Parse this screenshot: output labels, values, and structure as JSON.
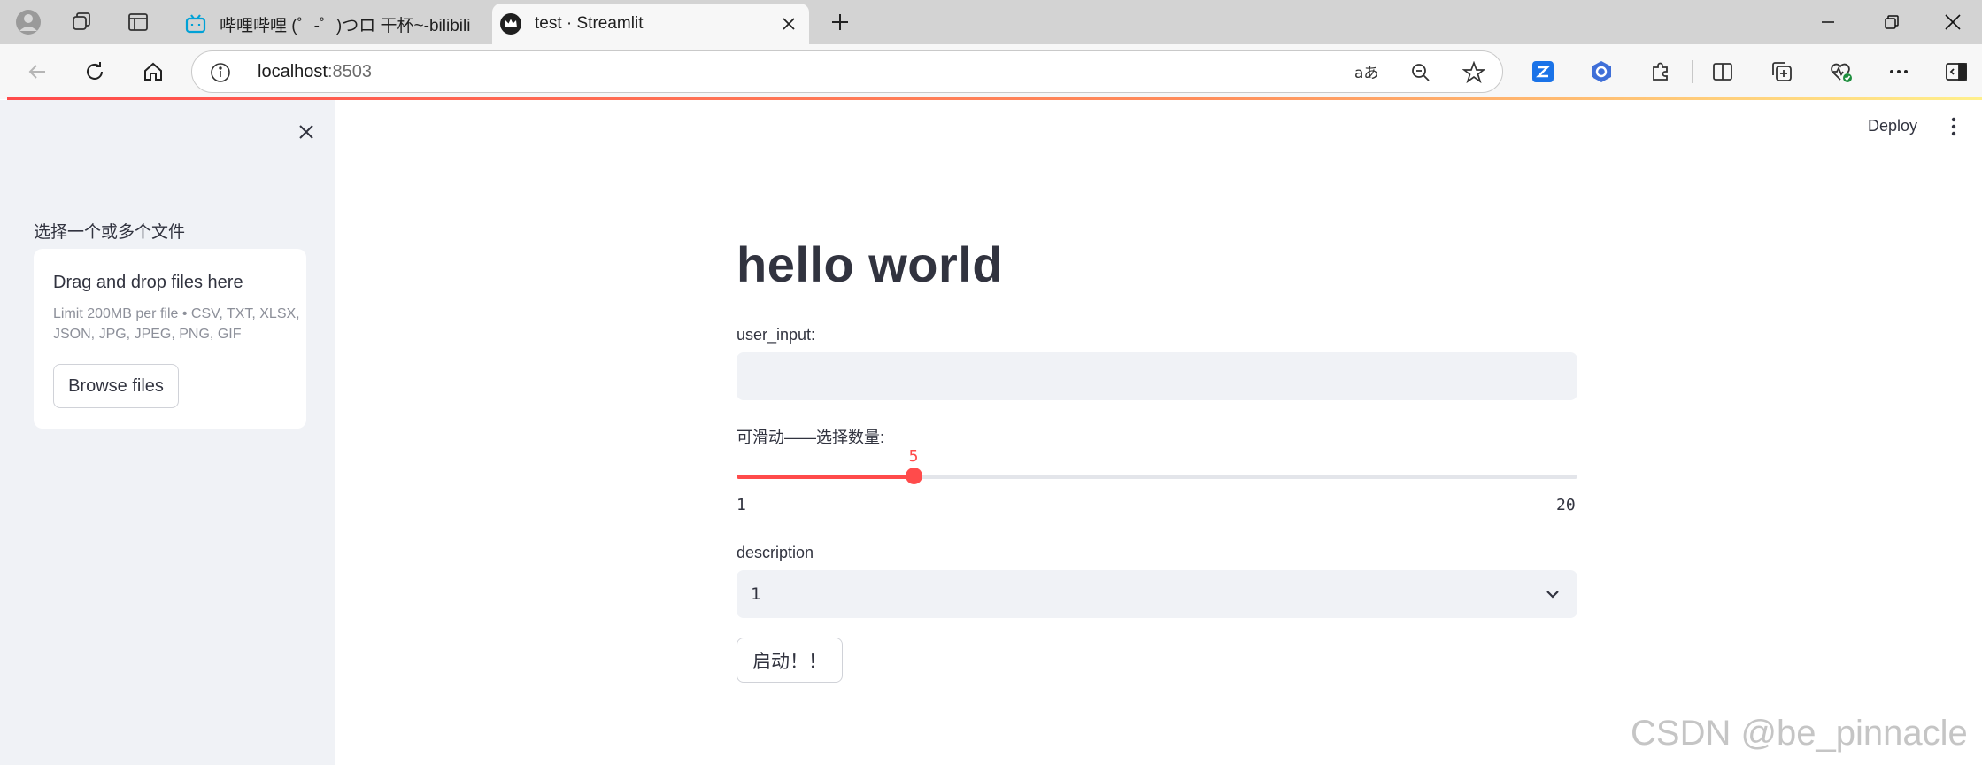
{
  "browser": {
    "tabs": [
      {
        "title": "哔哩哔哩 (゜-゜)つロ 干杯~-bilibili",
        "favicon": "bilibili-icon"
      },
      {
        "title": "test · Streamlit",
        "favicon": "streamlit-crown-icon"
      }
    ],
    "address": {
      "host": "localhost",
      "port": ":8503"
    },
    "accent_color": "#1a73e8"
  },
  "sidebar": {
    "uploader": {
      "label": "选择一个或多个文件",
      "drop_title": "Drag and drop files here",
      "limit_text": "Limit 200MB per file • CSV, TXT, XLSX, JSON, JPG, JPEG, PNG, GIF",
      "browse_label": "Browse files"
    }
  },
  "header": {
    "deploy_label": "Deploy"
  },
  "main": {
    "title": "hello world",
    "text_input": {
      "label": "user_input:",
      "value": ""
    },
    "slider": {
      "label": "可滑动——选择数量:",
      "value": 5,
      "min": 1,
      "max": 20,
      "value_text": "5",
      "min_text": "1",
      "max_text": "20",
      "color": "#ff4b4b"
    },
    "select": {
      "label": "description",
      "value": "1"
    },
    "button_label": "启动！！"
  },
  "watermark": "CSDN @be_pinnacle"
}
